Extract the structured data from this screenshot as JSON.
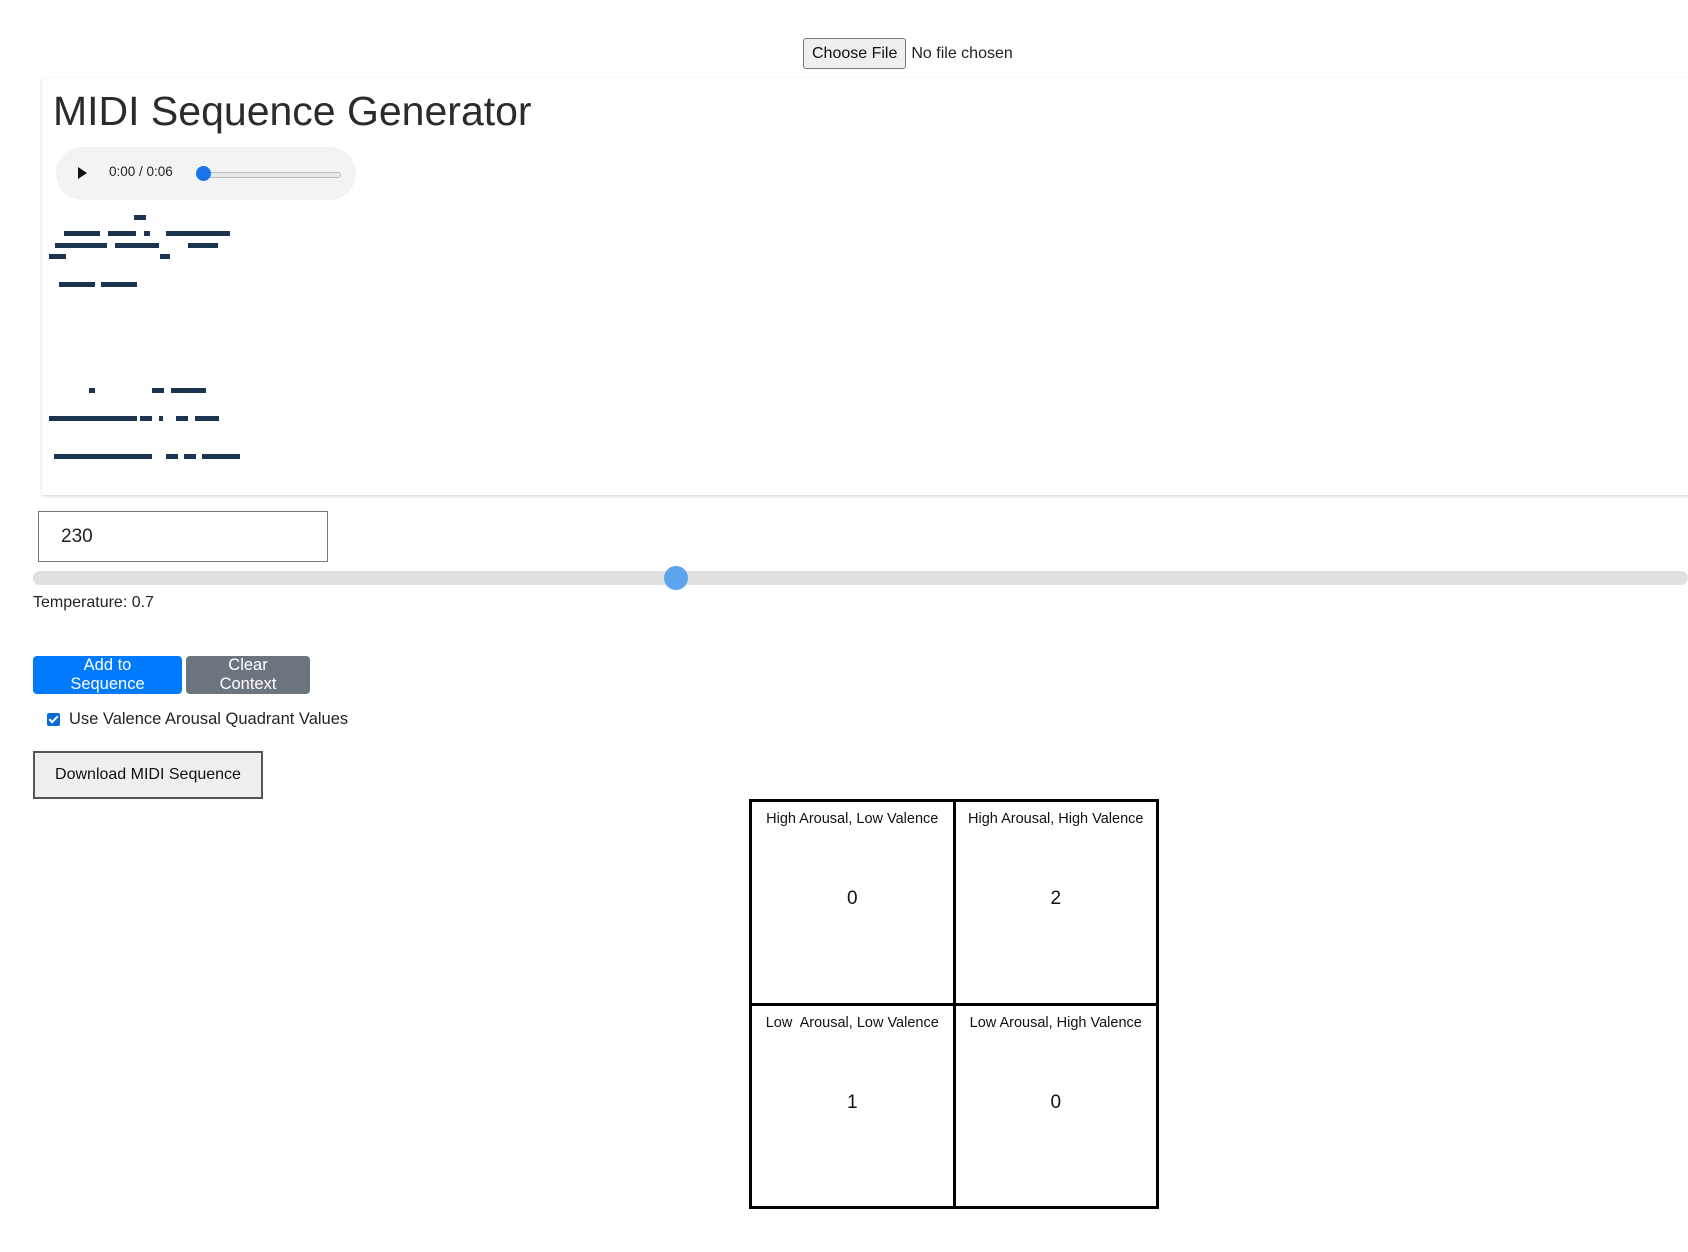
{
  "file_input": {
    "button_label": "Choose File",
    "status": "No file chosen"
  },
  "card": {
    "title": "MIDI Sequence Generator",
    "audio": {
      "time": "0:00 / 0:06",
      "progress": 0
    }
  },
  "controls": {
    "bpm_value": "230",
    "temperature_label": "Temperature: 0.7",
    "temperature_value": 0.7,
    "add_button": "Add to Sequence",
    "clear_button": "Clear Context",
    "checkbox_label": "Use Valence Arousal Quadrant Values",
    "checkbox_checked": true,
    "download_button": "Download MIDI Sequence"
  },
  "quadrants": [
    {
      "label": "High Arousal, Low Valence",
      "value": "0"
    },
    {
      "label": "High Arousal, High Valence",
      "value": "2"
    },
    {
      "label": "Low  Arousal, Low Valence",
      "value": "1"
    },
    {
      "label": "Low Arousal, High Valence",
      "value": "0"
    }
  ],
  "colors": {
    "primary": "#007bff",
    "secondary": "#6c757d",
    "note_color": "#1b3550",
    "slider_thumb": "#5ea4ec"
  }
}
